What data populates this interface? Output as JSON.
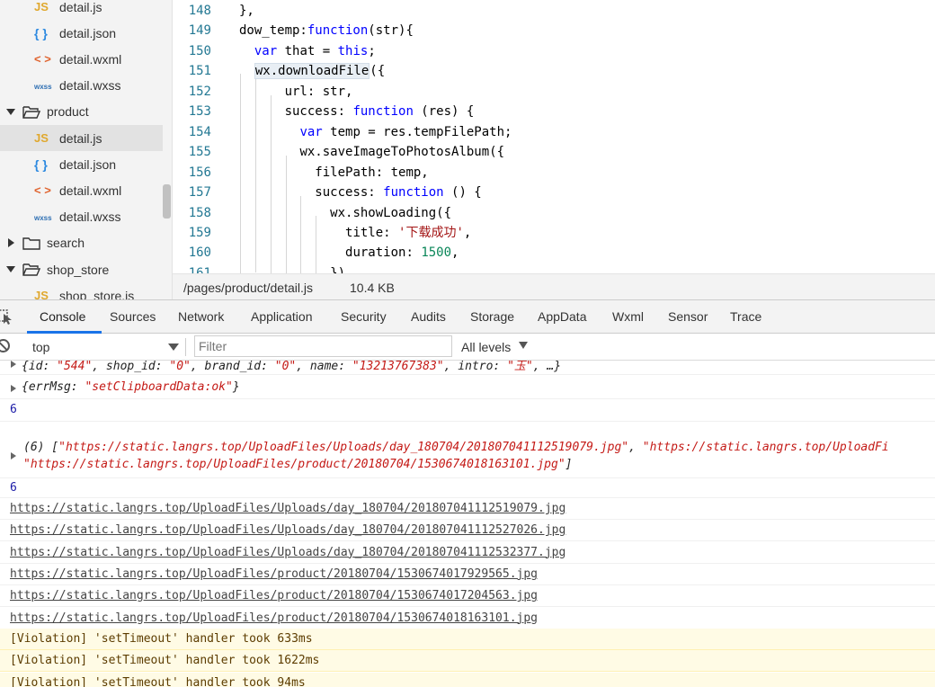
{
  "file_tree": {
    "items": [
      {
        "type": "file",
        "icon": "js-icon",
        "icon_text": "JS",
        "label": "detail.js"
      },
      {
        "type": "file",
        "icon": "json-icon",
        "icon_text": "{ }",
        "label": "detail.json"
      },
      {
        "type": "file",
        "icon": "wxml-icon",
        "icon_text": "< >",
        "label": "detail.wxml"
      },
      {
        "type": "file",
        "icon": "wxss-icon",
        "icon_text": "wxss",
        "label": "detail.wxss"
      },
      {
        "type": "folder",
        "expanded": true,
        "label": "product"
      },
      {
        "type": "file",
        "icon": "js-icon",
        "icon_text": "JS",
        "label": "detail.js",
        "selected": true
      },
      {
        "type": "file",
        "icon": "json-icon",
        "icon_text": "{ }",
        "label": "detail.json"
      },
      {
        "type": "file",
        "icon": "wxml-icon",
        "icon_text": "< >",
        "label": "detail.wxml"
      },
      {
        "type": "file",
        "icon": "wxss-icon",
        "icon_text": "wxss",
        "label": "detail.wxss"
      },
      {
        "type": "folder",
        "expanded": false,
        "label": "search"
      },
      {
        "type": "folder",
        "expanded": true,
        "label": "shop_store"
      },
      {
        "type": "file",
        "icon": "js-icon",
        "icon_text": "JS",
        "label": "shop_store.js"
      }
    ]
  },
  "editor": {
    "lines": [
      {
        "n": "148",
        "indent": 0,
        "parts": [
          [
            "t",
            "},"
          ]
        ]
      },
      {
        "n": "149",
        "indent": 0,
        "parts": [
          [
            "t",
            "dow_temp:"
          ],
          [
            "kw",
            "function"
          ],
          [
            "t",
            "(str){"
          ]
        ]
      },
      {
        "n": "150",
        "indent": 1,
        "parts": [
          [
            "kw",
            "var"
          ],
          [
            "t",
            " that = "
          ],
          [
            "kw",
            "this"
          ],
          [
            "t",
            ";"
          ]
        ]
      },
      {
        "n": "151",
        "indent": 1,
        "parts": [
          [
            "hl",
            "wx.downloadFile"
          ],
          [
            "t",
            "({"
          ]
        ]
      },
      {
        "n": "152",
        "indent": 3,
        "parts": [
          [
            "t",
            "url: str,"
          ]
        ]
      },
      {
        "n": "153",
        "indent": 3,
        "parts": [
          [
            "t",
            "success: "
          ],
          [
            "kw",
            "function"
          ],
          [
            "t",
            " (res) {"
          ]
        ]
      },
      {
        "n": "154",
        "indent": 4,
        "parts": [
          [
            "kw",
            "var"
          ],
          [
            "t",
            " temp = res.tempFilePath;"
          ]
        ]
      },
      {
        "n": "155",
        "indent": 4,
        "parts": [
          [
            "t",
            "wx.saveImageToPhotosAlbum({"
          ]
        ]
      },
      {
        "n": "156",
        "indent": 5,
        "parts": [
          [
            "t",
            "filePath: temp,"
          ]
        ]
      },
      {
        "n": "157",
        "indent": 5,
        "parts": [
          [
            "t",
            "success: "
          ],
          [
            "kw",
            "function"
          ],
          [
            "t",
            " () {"
          ]
        ]
      },
      {
        "n": "158",
        "indent": 6,
        "parts": [
          [
            "t",
            "wx.showLoading({"
          ]
        ]
      },
      {
        "n": "159",
        "indent": 7,
        "parts": [
          [
            "t",
            "title: "
          ],
          [
            "str",
            "'下载成功'"
          ],
          [
            "t",
            ","
          ]
        ]
      },
      {
        "n": "160",
        "indent": 7,
        "parts": [
          [
            "t",
            "duration: "
          ],
          [
            "num",
            "1500"
          ],
          [
            "t",
            ","
          ]
        ]
      },
      {
        "n": "161",
        "indent": 6,
        "parts": [
          [
            "t",
            "})"
          ]
        ]
      }
    ]
  },
  "status_bar": {
    "path": "/pages/product/detail.js",
    "size": "10.4 KB"
  },
  "devtools": {
    "tabs": [
      "Console",
      "Sources",
      "Network",
      "Application",
      "Security",
      "Audits",
      "Storage",
      "AppData",
      "Wxml",
      "Sensor",
      "Trace"
    ],
    "active_tab": "Console"
  },
  "console_toolbar": {
    "context": "top",
    "filter_placeholder": "Filter",
    "levels": "All levels"
  },
  "console": {
    "obj1": {
      "id_key": "id: ",
      "id_val": "\"544\"",
      "shop_key": ", shop_id: ",
      "shop_val": "\"0\"",
      "brand_key": ", brand_id: ",
      "brand_val": "\"0\"",
      "name_key": ", name: ",
      "name_val": "\"13213767383\"",
      "intro_key": ", intro: ",
      "intro_val": "\"玉\"",
      "tail": ", …}",
      "open": "{"
    },
    "obj2": {
      "open": "{errMsg: ",
      "val": "\"setClipboardData:ok\"",
      "close": "}"
    },
    "num1": "6",
    "array_prefix": "(6) [",
    "array_line1_a": "\"https://static.langrs.top/UploadFiles/Uploads/day_180704/201807041112519079.jpg\"",
    "array_line1_sep": ", ",
    "array_line1_b": "\"https://static.langrs.top/UploadFi",
    "array_line2": "\"https://static.langrs.top/UploadFiles/product/20180704/1530674018163101.jpg\"",
    "array_suffix": "]",
    "num2": "6",
    "links": [
      "https://static.langrs.top/UploadFiles/Uploads/day_180704/201807041112519079.jpg",
      "https://static.langrs.top/UploadFiles/Uploads/day_180704/201807041112527026.jpg",
      "https://static.langrs.top/UploadFiles/Uploads/day_180704/201807041112532377.jpg",
      "https://static.langrs.top/UploadFiles/product/20180704/1530674017929565.jpg",
      "https://static.langrs.top/UploadFiles/product/20180704/1530674017204563.jpg",
      "https://static.langrs.top/UploadFiles/product/20180704/1530674018163101.jpg"
    ],
    "violations": [
      "[Violation] 'setTimeout' handler took 633ms",
      "[Violation] 'setTimeout' handler took 1622ms",
      "[Violation] 'setTimeout' handler took 94ms"
    ]
  }
}
